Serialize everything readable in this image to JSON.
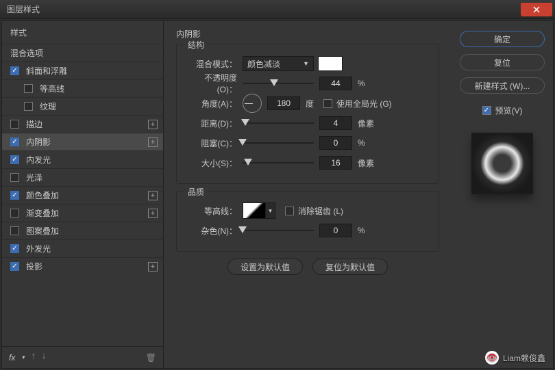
{
  "window": {
    "title": "图层样式"
  },
  "left": {
    "styles_header": "样式",
    "blend_header": "混合选项",
    "items": [
      {
        "label": "斜面和浮雕",
        "checked": true,
        "plus": false,
        "indent": false
      },
      {
        "label": "等高线",
        "checked": false,
        "plus": false,
        "indent": true
      },
      {
        "label": "纹理",
        "checked": false,
        "plus": false,
        "indent": true
      },
      {
        "label": "描边",
        "checked": false,
        "plus": true,
        "indent": false
      },
      {
        "label": "内阴影",
        "checked": true,
        "plus": true,
        "indent": false,
        "selected": true
      },
      {
        "label": "内发光",
        "checked": true,
        "plus": false,
        "indent": false
      },
      {
        "label": "光泽",
        "checked": false,
        "plus": false,
        "indent": false
      },
      {
        "label": "颜色叠加",
        "checked": true,
        "plus": true,
        "indent": false
      },
      {
        "label": "渐变叠加",
        "checked": false,
        "plus": true,
        "indent": false
      },
      {
        "label": "图案叠加",
        "checked": false,
        "plus": false,
        "indent": false
      },
      {
        "label": "外发光",
        "checked": true,
        "plus": false,
        "indent": false
      },
      {
        "label": "投影",
        "checked": true,
        "plus": true,
        "indent": false
      }
    ],
    "fx": "fx"
  },
  "center": {
    "title": "内阴影",
    "group1": "结构",
    "blend_mode_label": "混合模式：",
    "blend_mode_value": "颜色减淡",
    "opacity_label": "不透明度(O)：",
    "opacity_value": "44",
    "opacity_unit": "%",
    "angle_label": "角度(A)：",
    "angle_value": "180",
    "angle_unit": "度",
    "global_light": "使用全局光 (G)",
    "distance_label": "距离(D)：",
    "distance_value": "4",
    "distance_unit": "像素",
    "choke_label": "阻塞(C)：",
    "choke_value": "0",
    "choke_unit": "%",
    "size_label": "大小(S)：",
    "size_value": "16",
    "size_unit": "像素",
    "group2": "品质",
    "contour_label": "等高线：",
    "antialias": "消除锯齿 (L)",
    "noise_label": "杂色(N)：",
    "noise_value": "0",
    "noise_unit": "%",
    "btn_default": "设置为默认值",
    "btn_reset": "复位为默认值"
  },
  "right": {
    "ok": "确定",
    "cancel": "复位",
    "new_style": "新建样式 (W)...",
    "preview": "预览(V)"
  },
  "watermark": "Liam赖俊鑫"
}
